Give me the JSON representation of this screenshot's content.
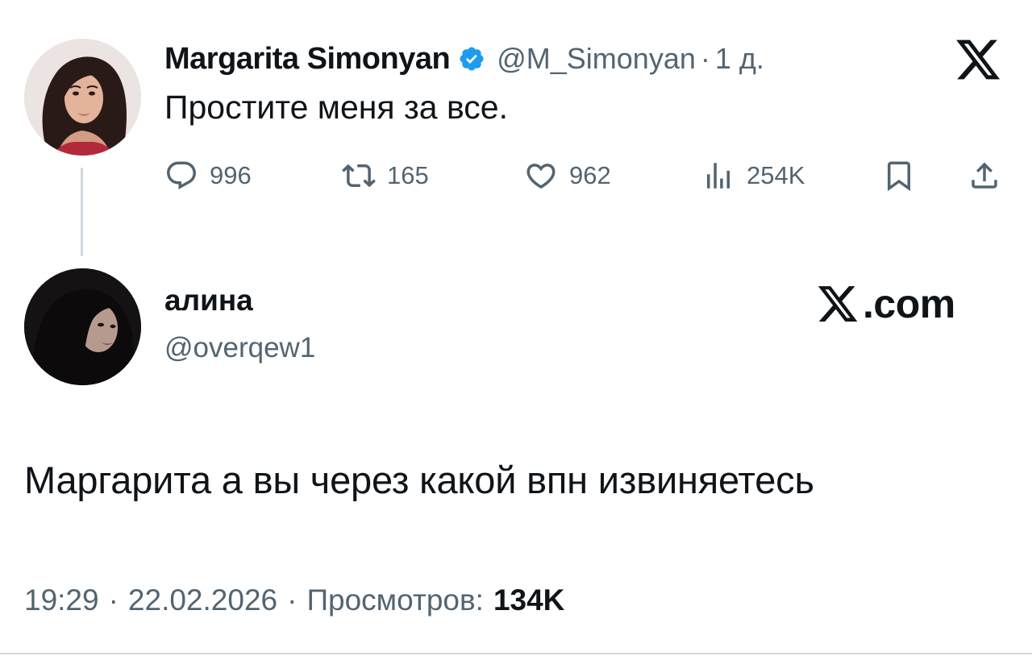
{
  "original_tweet": {
    "author": {
      "display_name": "Margarita Simonyan",
      "handle": "@M_Simonyan",
      "verified": true,
      "avatar_icon": "profile-photo-woman"
    },
    "separator": "·",
    "time_ago": "1 д.",
    "text": "Простите меня за все.",
    "metrics": {
      "replies": "996",
      "retweets": "165",
      "likes": "962",
      "views": "254K"
    },
    "icons": {
      "reply": "reply-icon",
      "retweet": "retweet-icon",
      "like": "heart-icon",
      "views": "analytics-icon",
      "bookmark": "bookmark-icon",
      "share": "share-icon",
      "platform": "x-logo-icon"
    }
  },
  "reply_tweet": {
    "author": {
      "display_name": "алина",
      "handle": "@overqew1",
      "avatar_icon": "profile-photo-dark"
    },
    "brand": ".com",
    "text": "Маргарита а вы через какой впн извиняетесь",
    "time": "19:29",
    "separator_1": "·",
    "date": "22.02.2026",
    "separator_2": "·",
    "views_label": "Просмотров:",
    "views_count": "134K"
  },
  "colors": {
    "text_primary": "#0f1419",
    "text_secondary": "#536471",
    "verified_blue": "#1d9bf0",
    "thread_line": "#cfd9de",
    "background": "#ffffff"
  }
}
